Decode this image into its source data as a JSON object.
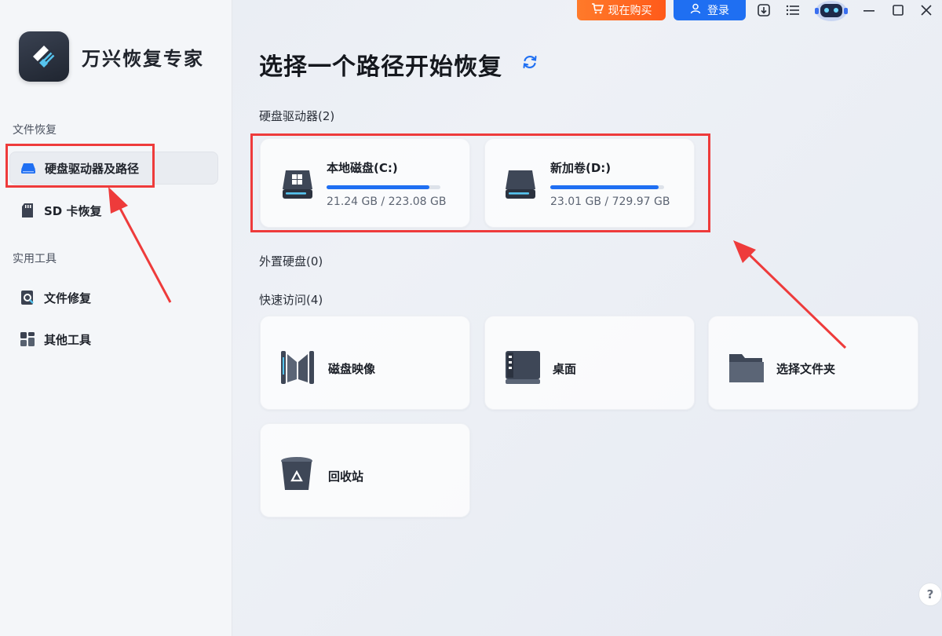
{
  "app": {
    "name": "万兴恢复专家"
  },
  "topbar": {
    "buy_label": "现在购买",
    "login_label": "登录"
  },
  "sidebar": {
    "section_file_recovery": "文件恢复",
    "item_drives": "硬盘驱动器及路径",
    "item_sd": "SD 卡恢复",
    "section_tools": "实用工具",
    "item_file_repair": "文件修复",
    "item_other_tools": "其他工具"
  },
  "main": {
    "title": "选择一个路径开始恢复",
    "hard_drives_label": "硬盘驱动器(2)",
    "external_label": "外置硬盘(0)",
    "quick_access_label": "快速访问(4)",
    "drives": [
      {
        "name": "本地磁盘(C:)",
        "size": "21.24 GB / 223.08 GB",
        "usage": 0.9
      },
      {
        "name": "新加卷(D:)",
        "size": "23.01 GB / 729.97 GB",
        "usage": 0.95
      }
    ],
    "quick": [
      {
        "label": "磁盘映像"
      },
      {
        "label": "桌面"
      },
      {
        "label": "选择文件夹"
      },
      {
        "label": "回收站"
      }
    ]
  },
  "help": {
    "label": "?"
  },
  "colors": {
    "accent": "#1f6ff2",
    "highlight": "#ee3b3b",
    "buy": "#ff6a22"
  }
}
